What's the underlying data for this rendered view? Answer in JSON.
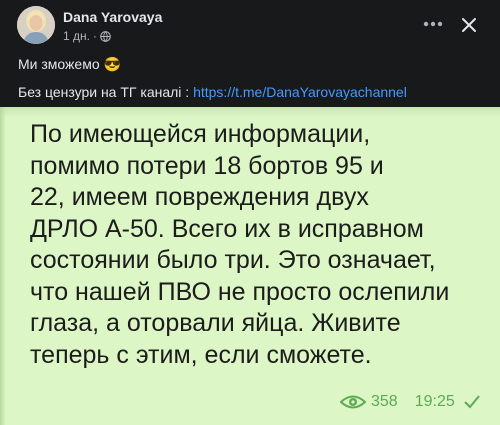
{
  "post": {
    "author": "Dana Yarovaya",
    "time": "1 дн.",
    "separator": "·",
    "text_line1": "Ми зможемо 😎",
    "text_line2_prefix": "Без цензури на ТГ каналі : ",
    "link": "https://t.me/DanaYarovayachannel"
  },
  "header_icons": {
    "privacy": "globe-icon",
    "more": "more-icon",
    "close": "close-icon"
  },
  "telegram": {
    "message": "По имеющейся информации,\nпомимо потери 18 бортов 95 и\n22, имеем повреждения двух\nДРЛО А-50. Всего их в исправном\nсостоянии было три. Это означает,\nчто нашей ПВО не просто ослепили\nглаза, а оторвали яйца. Живите\nтеперь с этим, если сможете.",
    "views": "358",
    "time": "19:25"
  },
  "colors": {
    "background": "#18191a",
    "link": "#4599ff",
    "bubble": "#dcf6c6",
    "meta_green": "#5eaa53"
  }
}
